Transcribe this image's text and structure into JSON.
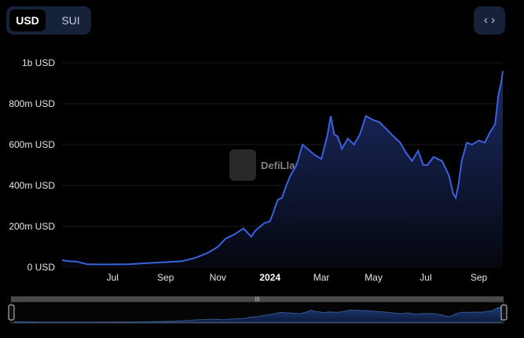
{
  "currency_toggle": {
    "usd_label": "USD",
    "sui_label": "SUI",
    "selected": "USD"
  },
  "embed_icon": "code-brackets-icon",
  "watermark": {
    "text": "DefiLlama",
    "icon": "llama-logo-icon"
  },
  "colors": {
    "line": "#3a62e0",
    "fill_top": "#1d2e6a",
    "fill_bottom": "#05070f",
    "grid": "#1c1c1c",
    "toggle_bg": "#16213a"
  },
  "chart_data": {
    "type": "area",
    "title": "",
    "xlabel": "",
    "ylabel": "",
    "ylim": [
      0,
      1000000000
    ],
    "yticks": [
      {
        "value": 0,
        "label": "0 USD"
      },
      {
        "value": 200000000,
        "label": "200m USD"
      },
      {
        "value": 400000000,
        "label": "400m USD"
      },
      {
        "value": 600000000,
        "label": "600m USD"
      },
      {
        "value": 800000000,
        "label": "800m USD"
      },
      {
        "value": 1000000000,
        "label": "1b USD"
      }
    ],
    "xlim": [
      "2023-05-03",
      "2024-09-29"
    ],
    "xticks": [
      {
        "date": "2023-07-01",
        "label": "Jul",
        "bold": false
      },
      {
        "date": "2023-09-01",
        "label": "Sep",
        "bold": false
      },
      {
        "date": "2023-11-01",
        "label": "Nov",
        "bold": false
      },
      {
        "date": "2024-01-01",
        "label": "2024",
        "bold": true
      },
      {
        "date": "2024-03-01",
        "label": "Mar",
        "bold": false
      },
      {
        "date": "2024-05-01",
        "label": "May",
        "bold": false
      },
      {
        "date": "2024-07-01",
        "label": "Jul",
        "bold": false
      },
      {
        "date": "2024-09-01",
        "label": "Sep",
        "bold": false
      }
    ],
    "grid": true,
    "series": [
      {
        "x": [
          "2023-05-03",
          "2023-05-10",
          "2023-05-20",
          "2023-06-01",
          "2023-06-15",
          "2023-07-01",
          "2023-07-20",
          "2023-08-10",
          "2023-09-01",
          "2023-09-20",
          "2023-10-05",
          "2023-10-20",
          "2023-11-01",
          "2023-11-10",
          "2023-11-20",
          "2023-12-01",
          "2023-12-10",
          "2023-12-15",
          "2023-12-25",
          "2024-01-01",
          "2024-01-05",
          "2024-01-10",
          "2024-01-15",
          "2024-01-20",
          "2024-01-25",
          "2024-02-01",
          "2024-02-08",
          "2024-02-15",
          "2024-02-22",
          "2024-03-01",
          "2024-03-08",
          "2024-03-12",
          "2024-03-16",
          "2024-03-20",
          "2024-03-25",
          "2024-04-01",
          "2024-04-08",
          "2024-04-15",
          "2024-04-22",
          "2024-05-01",
          "2024-05-08",
          "2024-05-15",
          "2024-05-22",
          "2024-06-01",
          "2024-06-08",
          "2024-06-15",
          "2024-06-22",
          "2024-06-28",
          "2024-07-03",
          "2024-07-10",
          "2024-07-20",
          "2024-07-28",
          "2024-08-02",
          "2024-08-05",
          "2024-08-08",
          "2024-08-12",
          "2024-08-18",
          "2024-08-24",
          "2024-09-01",
          "2024-09-08",
          "2024-09-14",
          "2024-09-20",
          "2024-09-24",
          "2024-09-27",
          "2024-09-29"
        ],
        "values": [
          35000000,
          30000000,
          28000000,
          15000000,
          14000000,
          14000000,
          15000000,
          20000000,
          25000000,
          30000000,
          45000000,
          70000000,
          100000000,
          140000000,
          160000000,
          190000000,
          150000000,
          180000000,
          215000000,
          225000000,
          270000000,
          330000000,
          340000000,
          400000000,
          450000000,
          500000000,
          600000000,
          575000000,
          550000000,
          530000000,
          645000000,
          740000000,
          650000000,
          640000000,
          580000000,
          630000000,
          600000000,
          650000000,
          740000000,
          720000000,
          710000000,
          680000000,
          650000000,
          610000000,
          560000000,
          520000000,
          570000000,
          500000000,
          500000000,
          540000000,
          520000000,
          450000000,
          360000000,
          340000000,
          400000000,
          520000000,
          610000000,
          600000000,
          620000000,
          610000000,
          660000000,
          700000000,
          850000000,
          900000000,
          960000000
        ]
      }
    ]
  }
}
